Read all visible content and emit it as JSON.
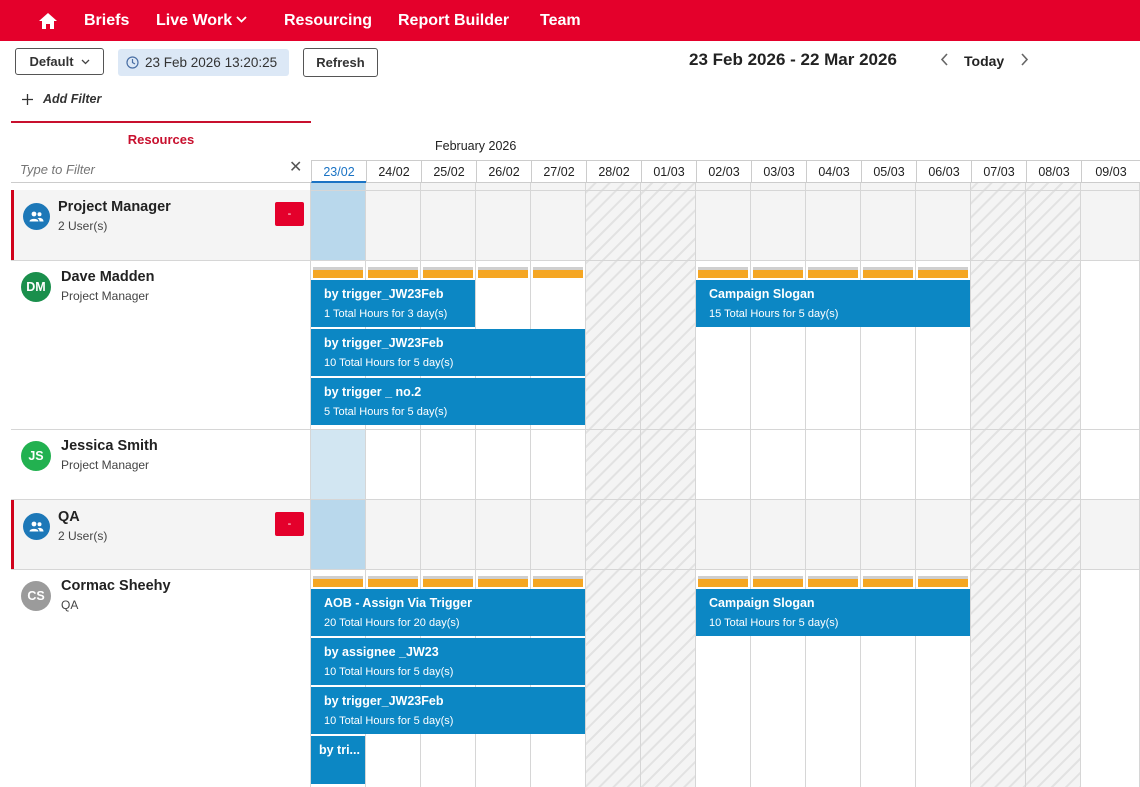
{
  "nav": {
    "items": [
      "Briefs",
      "Live Work",
      "Resourcing",
      "Report Builder",
      "Team"
    ],
    "active": "Resourcing"
  },
  "toolbar": {
    "view_label": "Default",
    "timestamp": "23 Feb 2026 13:20:25",
    "refresh_label": "Refresh",
    "date_range": "23 Feb 2026 - 22 Mar 2026",
    "today_label": "Today",
    "add_filter_label": "Add Filter"
  },
  "resources": {
    "header": "Resources",
    "filter_placeholder": "Type to Filter"
  },
  "calendar": {
    "month": "February 2026",
    "days": [
      "23/02",
      "24/02",
      "25/02",
      "26/02",
      "27/02",
      "28/02",
      "01/03",
      "02/03",
      "03/03",
      "04/03",
      "05/03",
      "06/03",
      "07/03",
      "08/03",
      "09/03"
    ],
    "today": "23/02"
  },
  "groups": [
    {
      "name": "Project Manager",
      "count": "2 User(s)",
      "collapse_label": "-"
    },
    {
      "name": "QA",
      "count": "2 User(s)",
      "collapse_label": "-"
    }
  ],
  "users": [
    {
      "initials": "DM",
      "name": "Dave Madden",
      "role": "Project Manager",
      "color": "#1a8f4c"
    },
    {
      "initials": "JS",
      "name": "Jessica Smith",
      "role": "Project Manager",
      "color": "#22b150"
    },
    {
      "initials": "CS",
      "name": "Cormac Sheehy",
      "role": "QA",
      "color": "#9b9b9b"
    }
  ],
  "bookings": {
    "dave": [
      {
        "title": "by trigger_JW23Feb",
        "sub": "1 Total Hours for 3 day(s)"
      },
      {
        "title": "Campaign Slogan",
        "sub": "15 Total Hours for 5 day(s)"
      },
      {
        "title": "by trigger_JW23Feb",
        "sub": "10 Total Hours for 5 day(s)"
      },
      {
        "title": "by trigger _ no.2",
        "sub": "5 Total Hours for 5 day(s)"
      }
    ],
    "cormac": [
      {
        "title": "AOB - Assign Via Trigger",
        "sub": "20 Total Hours for 20 day(s)"
      },
      {
        "title": "Campaign Slogan",
        "sub": "10 Total Hours for 5 day(s)"
      },
      {
        "title": "by assignee _JW23",
        "sub": "10 Total Hours for 5 day(s)"
      },
      {
        "title": "by trigger_JW23Feb",
        "sub": "10 Total Hours for 5 day(s)"
      },
      {
        "title": "by tri...",
        "sub": ""
      }
    ]
  },
  "colors": {
    "brand": "#e4002b",
    "booking": "#0c87c4",
    "capacity": "#f5a623",
    "today_column": "#b9d8ec"
  }
}
